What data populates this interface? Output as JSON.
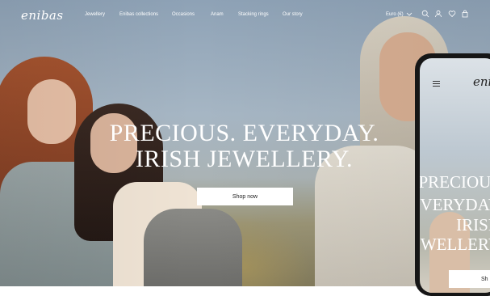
{
  "brand": {
    "logo": "enibas"
  },
  "nav": {
    "items": [
      "Jewellery",
      "Enibas collections",
      "Occasions",
      "Anam",
      "Stacking rings",
      "Our story"
    ],
    "currency": "Euro (€)"
  },
  "hero": {
    "headline_line1": "PRECIOUS. EVERYDAY.",
    "headline_line2": "IRISH JEWELLERY.",
    "cta_label": "Shop now"
  },
  "mobile_preview": {
    "logo": "eni",
    "headline_lines": [
      "PRECIOUS",
      "EVERYDAY",
      "IRISH",
      "JEWELLERY"
    ],
    "cta_label": "Sh"
  },
  "icons": [
    "chevron-down-icon",
    "search-icon",
    "user-icon",
    "heart-icon",
    "bag-icon",
    "menu-icon"
  ]
}
